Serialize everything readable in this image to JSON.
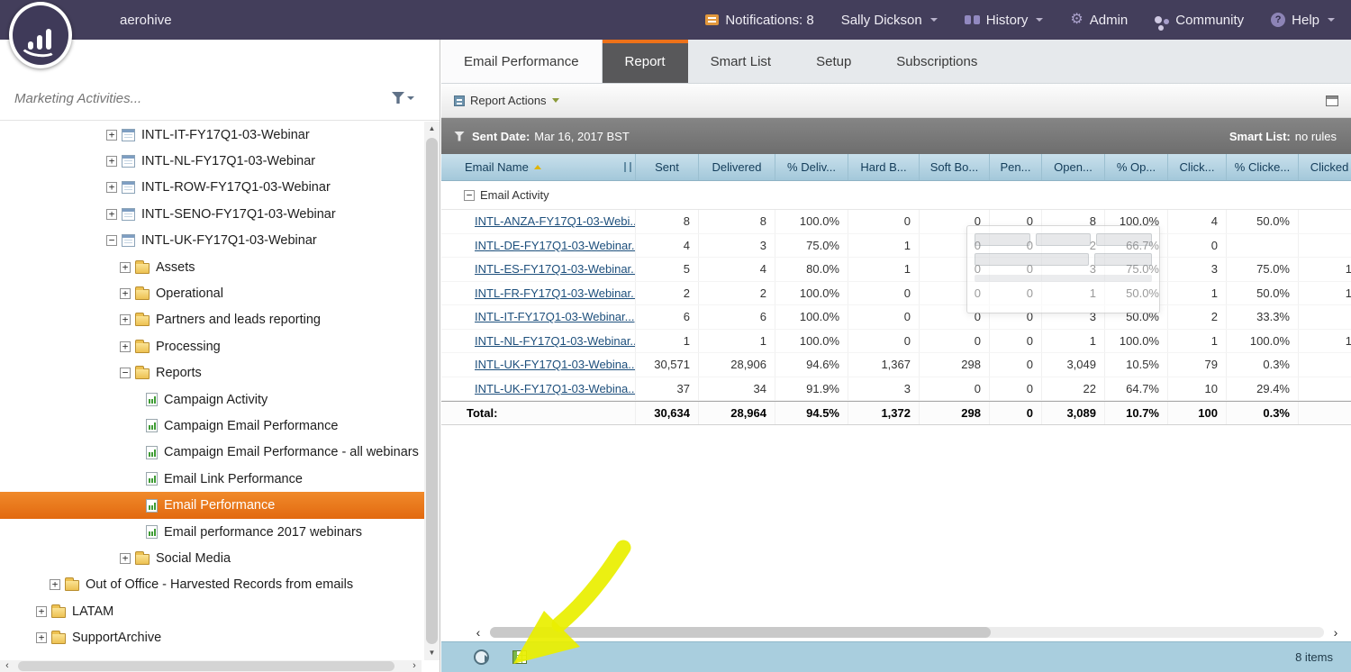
{
  "topbar": {
    "brand": "aerohive",
    "notifications_label": "Notifications: 8",
    "user_label": "Sally Dickson",
    "history_label": "History",
    "admin_label": "Admin",
    "community_label": "Community",
    "help_label": "Help"
  },
  "sidebar": {
    "search_placeholder": "Marketing Activities...",
    "tree": [
      {
        "label": "INTL-IT-FY17Q1-03-Webinar",
        "indent": 118,
        "expander": "closed",
        "icon": "program",
        "selected": false
      },
      {
        "label": "INTL-NL-FY17Q1-03-Webinar",
        "indent": 118,
        "expander": "closed",
        "icon": "program",
        "selected": false
      },
      {
        "label": "INTL-ROW-FY17Q1-03-Webinar",
        "indent": 118,
        "expander": "closed",
        "icon": "program",
        "selected": false
      },
      {
        "label": "INTL-SENO-FY17Q1-03-Webinar",
        "indent": 118,
        "expander": "closed",
        "icon": "program",
        "selected": false
      },
      {
        "label": "INTL-UK-FY17Q1-03-Webinar",
        "indent": 118,
        "expander": "open",
        "icon": "program",
        "selected": false
      },
      {
        "label": "Assets",
        "indent": 133,
        "expander": "closed",
        "icon": "folder",
        "selected": false
      },
      {
        "label": "Operational",
        "indent": 133,
        "expander": "closed",
        "icon": "folder",
        "selected": false
      },
      {
        "label": "Partners and leads reporting",
        "indent": 133,
        "expander": "closed",
        "icon": "folder",
        "selected": false
      },
      {
        "label": "Processing",
        "indent": 133,
        "expander": "closed",
        "icon": "folder",
        "selected": false
      },
      {
        "label": "Reports",
        "indent": 133,
        "expander": "open",
        "icon": "folder",
        "selected": false
      },
      {
        "label": "Campaign Activity",
        "indent": 162,
        "expander": null,
        "icon": "report",
        "selected": false
      },
      {
        "label": "Campaign Email Performance",
        "indent": 162,
        "expander": null,
        "icon": "report",
        "selected": false
      },
      {
        "label": "Campaign Email Performance - all webinars",
        "indent": 162,
        "expander": null,
        "icon": "report",
        "selected": false
      },
      {
        "label": "Email Link Performance",
        "indent": 162,
        "expander": null,
        "icon": "report",
        "selected": false
      },
      {
        "label": "Email Performance",
        "indent": 162,
        "expander": null,
        "icon": "report",
        "selected": true
      },
      {
        "label": "Email performance 2017 webinars",
        "indent": 162,
        "expander": null,
        "icon": "report",
        "selected": false
      },
      {
        "label": "Social Media",
        "indent": 133,
        "expander": "closed",
        "icon": "folder",
        "selected": false
      },
      {
        "label": "Out of Office - Harvested Records from emails",
        "indent": 55,
        "expander": "closed",
        "icon": "folder",
        "selected": false
      },
      {
        "label": "LATAM",
        "indent": 40,
        "expander": "closed",
        "icon": "folder",
        "selected": false
      },
      {
        "label": "SupportArchive",
        "indent": 40,
        "expander": "closed",
        "icon": "folder",
        "selected": false
      }
    ]
  },
  "tabs": [
    {
      "label": "Email Performance",
      "state": "asset"
    },
    {
      "label": "Report",
      "state": "active"
    },
    {
      "label": "Smart List",
      "state": "normal"
    },
    {
      "label": "Setup",
      "state": "normal"
    },
    {
      "label": "Subscriptions",
      "state": "normal"
    }
  ],
  "actions_bar": {
    "label": "Report Actions"
  },
  "filter_bar": {
    "sent_date_label": "Sent Date:",
    "sent_date_value": "Mar 16, 2017 BST",
    "smart_list_label": "Smart List:",
    "smart_list_value": "no rules"
  },
  "table": {
    "columns": [
      "Email Name",
      "Sent",
      "Delivered",
      "% Deliv...",
      "Hard B...",
      "Soft Bo...",
      "Pen...",
      "Open...",
      "% Op...",
      "Click...",
      "% Clicke...",
      "Clicked"
    ],
    "group_label": "Email Activity",
    "rows": [
      {
        "name": "INTL-ANZA-FY17Q1-03-Webi...",
        "values": [
          "8",
          "8",
          "100.0%",
          "0",
          "0",
          "0",
          "8",
          "100.0%",
          "4",
          "50.0%",
          ""
        ]
      },
      {
        "name": "INTL-DE-FY17Q1-03-Webinar...",
        "values": [
          "4",
          "3",
          "75.0%",
          "1",
          "0",
          "0",
          "2",
          "66.7%",
          "0",
          "",
          ""
        ]
      },
      {
        "name": "INTL-ES-FY17Q1-03-Webinar...",
        "values": [
          "5",
          "4",
          "80.0%",
          "1",
          "0",
          "0",
          "3",
          "75.0%",
          "3",
          "75.0%",
          "1"
        ]
      },
      {
        "name": "INTL-FR-FY17Q1-03-Webinar...",
        "values": [
          "2",
          "2",
          "100.0%",
          "0",
          "0",
          "0",
          "1",
          "50.0%",
          "1",
          "50.0%",
          "1"
        ]
      },
      {
        "name": "INTL-IT-FY17Q1-03-Webinar...",
        "values": [
          "6",
          "6",
          "100.0%",
          "0",
          "0",
          "0",
          "3",
          "50.0%",
          "2",
          "33.3%",
          ""
        ]
      },
      {
        "name": "INTL-NL-FY17Q1-03-Webinar...",
        "values": [
          "1",
          "1",
          "100.0%",
          "0",
          "0",
          "0",
          "1",
          "100.0%",
          "1",
          "100.0%",
          "1"
        ]
      },
      {
        "name": "INTL-UK-FY17Q1-03-Webina...",
        "values": [
          "30,571",
          "28,906",
          "94.6%",
          "1,367",
          "298",
          "0",
          "3,049",
          "10.5%",
          "79",
          "0.3%",
          ""
        ]
      },
      {
        "name": "INTL-UK-FY17Q1-03-Webina...",
        "values": [
          "37",
          "34",
          "91.9%",
          "3",
          "0",
          "0",
          "22",
          "64.7%",
          "10",
          "29.4%",
          ""
        ]
      }
    ],
    "total_label": "Total:",
    "total_values": [
      "30,634",
      "28,964",
      "94.5%",
      "1,372",
      "298",
      "0",
      "3,089",
      "10.7%",
      "100",
      "0.3%",
      ""
    ]
  },
  "footer": {
    "items_label": "8 items"
  },
  "colors": {
    "topbar_bg": "#433e5b",
    "selected_orange": "#e8700f",
    "tab_orange": "#ee7219",
    "table_header_blue": "#b5d5e5",
    "footer_blue": "#a9cede",
    "annotation_yellow": "#e9ef00"
  }
}
